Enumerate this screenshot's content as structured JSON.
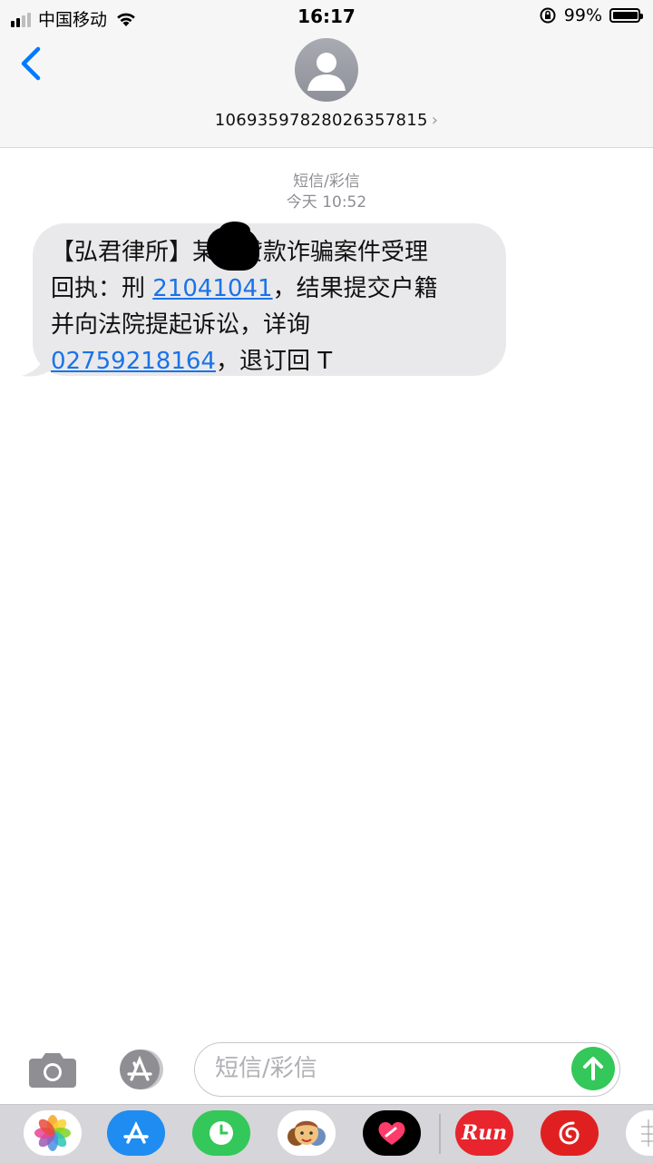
{
  "status_bar": {
    "carrier": "中国移动",
    "time": "16:17",
    "battery_percent": "99%",
    "signal_bars_active": 2,
    "battery_level": 0.99,
    "icons": [
      "signal-icon",
      "wifi-icon",
      "orientation-lock-icon",
      "battery-icon"
    ]
  },
  "header": {
    "contact_number": "1069359782802635781​5",
    "contact_chevron": "›"
  },
  "conversation": {
    "service_label": "短信/彩信",
    "timestamp": "今天 10:52",
    "message": {
      "line1": "【弘君律所】某某贷款诈骗案件受理",
      "line2_prefix": "回执：刑 ",
      "case_number": "21041041",
      "line2_suffix": "，结果提交户籍",
      "line3": "并向法院提起诉讼，详询",
      "phone_number": "02759218164",
      "line4_suffix": "，退订回 T"
    }
  },
  "composer": {
    "placeholder": "短信/彩信",
    "send_color": "#34c759"
  },
  "dock": {
    "apps": [
      "photos-icon",
      "app-store-icon",
      "screen-time-icon",
      "memoji-icon",
      "digital-touch-icon",
      "run-icon",
      "netease-music-icon",
      "more-apps-icon"
    ],
    "run_label": "Run"
  },
  "colors": {
    "link": "#1a73e8",
    "bubble": "#e9e9eb",
    "accent_blue": "#007aff"
  }
}
